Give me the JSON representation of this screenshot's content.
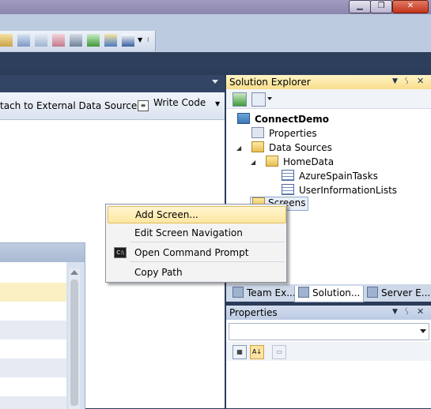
{
  "doc": {
    "attach_label": "tach to External Data Source...",
    "write_code_label": "Write Code",
    "write_code_arrow": "▼"
  },
  "solution_explorer": {
    "title": "Solution Explorer",
    "header_buttons": [
      "▼",
      "ᛊ",
      "✕"
    ],
    "tree": {
      "project": "ConnectDemo",
      "properties": "Properties",
      "data_sources": "Data Sources",
      "home_data": "HomeData",
      "table1": "AzureSpainTasks",
      "table2": "UserInformationLists",
      "screens": "Screens"
    }
  },
  "bottom_tabs": [
    "Team Ex...",
    "Solution...",
    "Server E..."
  ],
  "properties_panel": {
    "title": "Properties",
    "header_buttons": [
      "▼",
      "ᛊ",
      "✕"
    ]
  },
  "context_menu": {
    "items": [
      "Add Screen...",
      "Edit Screen Navigation",
      "Open Command Prompt",
      "Copy Path"
    ]
  },
  "window_buttons": {
    "minimize": "▁",
    "maximize": "❐",
    "close": "✕"
  },
  "colors": {
    "accent": "#f8dd8c",
    "highlight": "#fde7a1",
    "background": "#2b3c59"
  }
}
